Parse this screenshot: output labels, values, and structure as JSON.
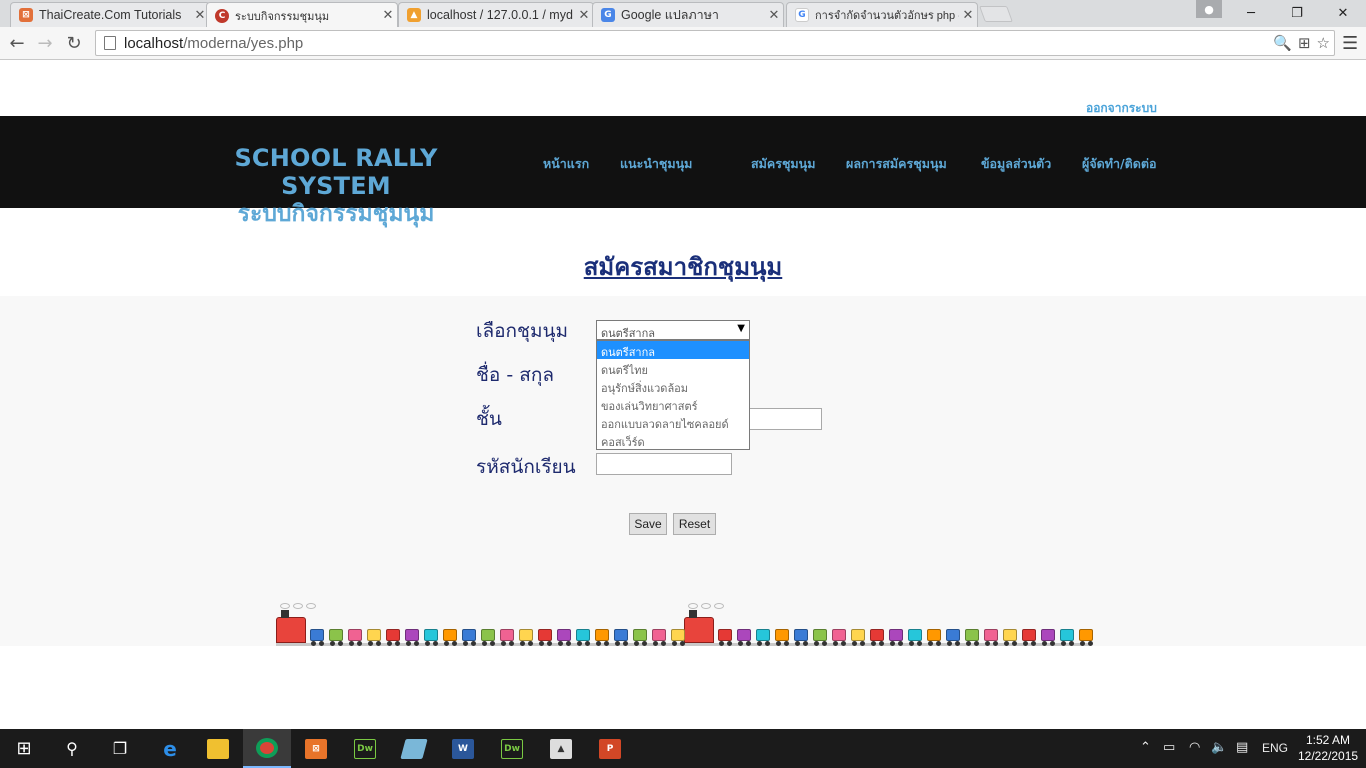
{
  "browser": {
    "tabs": [
      {
        "title": "ThaiCreate.Com Tutorials",
        "icon": "thaicreate-favicon",
        "color": "#e2703a"
      },
      {
        "title": "ระบบกิจกรรมชุมนุม",
        "icon": "site-favicon",
        "color": "#c0392b"
      },
      {
        "title": "localhost / 127.0.0.1 / myd",
        "icon": "phpmyadmin-favicon",
        "color": "#f0a030"
      },
      {
        "title": "Google แปลภาษา",
        "icon": "google-translate-favicon",
        "color": "#4a86e8"
      },
      {
        "title": "การจำกัดจำนวนตัวอักษร php -",
        "icon": "google-favicon",
        "color": "#4285f4"
      }
    ],
    "address": {
      "host": "localhost",
      "path": "/moderna/yes.php"
    }
  },
  "page": {
    "logout_link": "ออกจากระบบ",
    "site_title_en": "SCHOOL RALLY SYSTEM",
    "site_title_th": "ระบบกิจกรรมชุมนุม",
    "nav": [
      "หน้าแรก",
      "แนะนำชุมนุม",
      "สมัครชุมนุม",
      "ผลการสมัครชุมนุม",
      "ข้อมูลส่วนตัว",
      "ผู้จัดทำ/ติดต่อ"
    ],
    "form_title": "สมัครสมาชิกชุมนุม",
    "labels": {
      "club": "เลือกชุมนุม",
      "name": "ชื่อ - สกุล",
      "grade": "ชั้น",
      "student_id": "รหัสนักเรียน"
    },
    "club_select": {
      "selected": "ดนตรีสากล",
      "options": [
        "ดนตรีสากล",
        "ดนตรีไทย",
        "อนุรักษ์สิ่งแวดล้อม",
        "ของเล่นวิทยาศาสตร์",
        "ออกแบบลวดลายไซคลอยด์",
        "คอสเว็ร์ด"
      ]
    },
    "buttons": {
      "save": "Save",
      "reset": "Reset"
    }
  },
  "taskbar": {
    "clock_time": "1:52 AM",
    "clock_date": "12/22/2015",
    "language": "ENG"
  },
  "colors": {
    "header_bg": "#111111",
    "accent": "#5ea8d6",
    "form_title": "#1a2f7a",
    "selected_option": "#1e90ff"
  }
}
